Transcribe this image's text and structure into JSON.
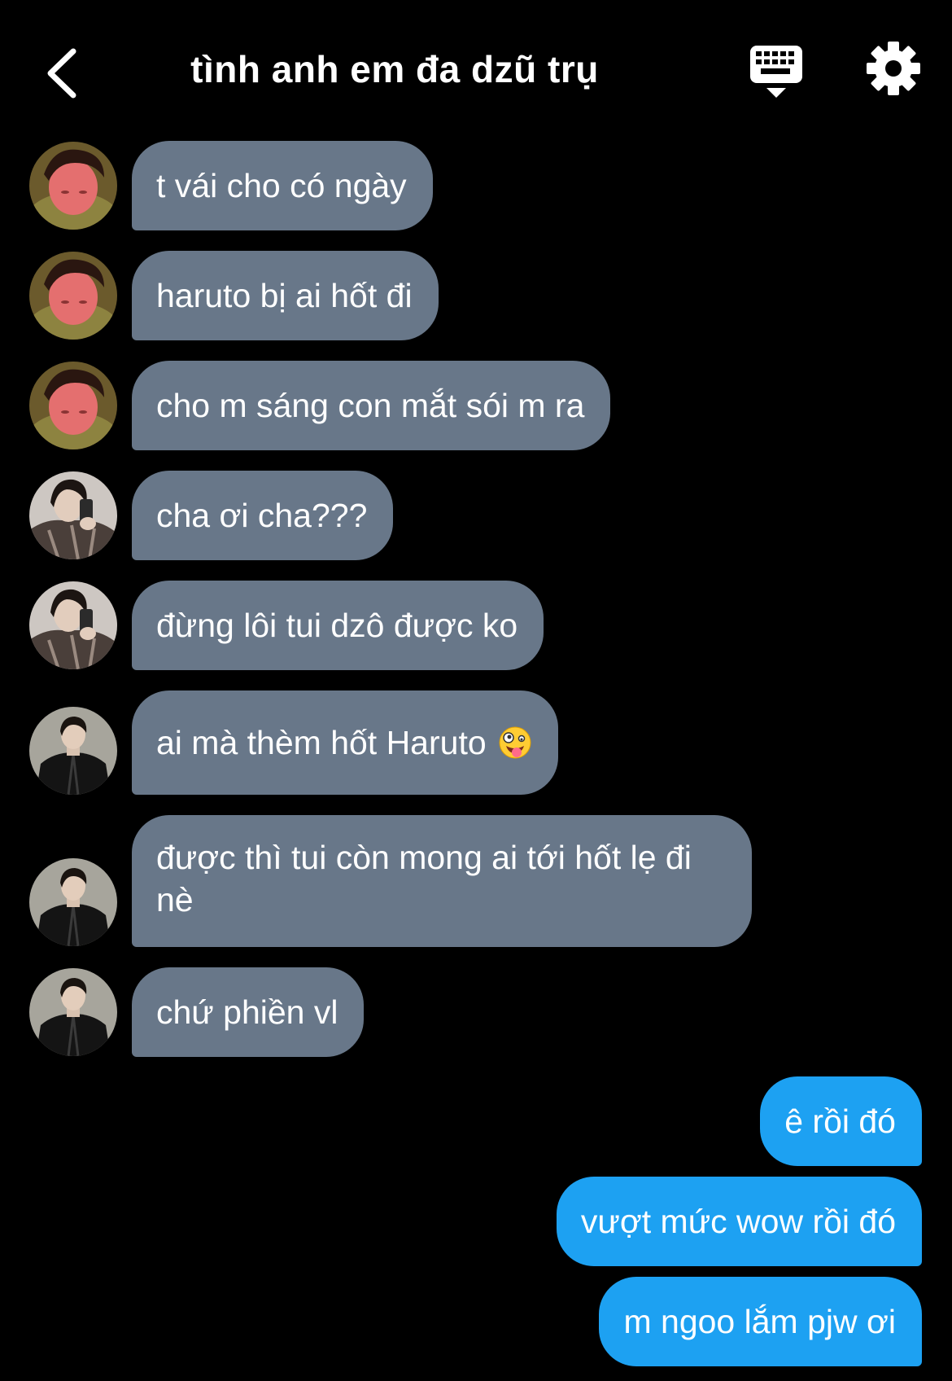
{
  "header": {
    "title": "tình anh em đa dzũ trụ",
    "back_icon": "chevron-left-icon",
    "keyboard_icon": "keyboard-icon",
    "settings_icon": "gear-icon"
  },
  "colors": {
    "background": "#000000",
    "incoming_bubble": "#687789",
    "outgoing_bubble": "#1da1f2",
    "text": "#ffffff"
  },
  "messages": [
    {
      "direction": "incoming",
      "avatar": "user-a",
      "text": "t vái cho có ngày"
    },
    {
      "direction": "incoming",
      "avatar": "user-a",
      "text": "haruto bị ai hốt đi"
    },
    {
      "direction": "incoming",
      "avatar": "user-a",
      "text": "cho m sáng con mắt sói m ra"
    },
    {
      "direction": "incoming",
      "avatar": "user-b",
      "text": "cha ơi cha???"
    },
    {
      "direction": "incoming",
      "avatar": "user-b",
      "text": "đừng lôi tui dzô được ko"
    },
    {
      "direction": "incoming",
      "avatar": "user-c",
      "text": "ai mà thèm hốt Haruto",
      "emoji": "zany-face-emoji"
    },
    {
      "direction": "incoming",
      "avatar": "user-c",
      "text": "được thì tui còn mong ai tới hốt lẹ đi nè"
    },
    {
      "direction": "incoming",
      "avatar": "user-c",
      "text": "chứ phiền vl"
    },
    {
      "direction": "outgoing",
      "text": "ê rồi đó"
    },
    {
      "direction": "outgoing",
      "text": "vượt mức wow rồi đó"
    },
    {
      "direction": "outgoing",
      "text": "m ngoo lắm pjw ơi"
    }
  ]
}
